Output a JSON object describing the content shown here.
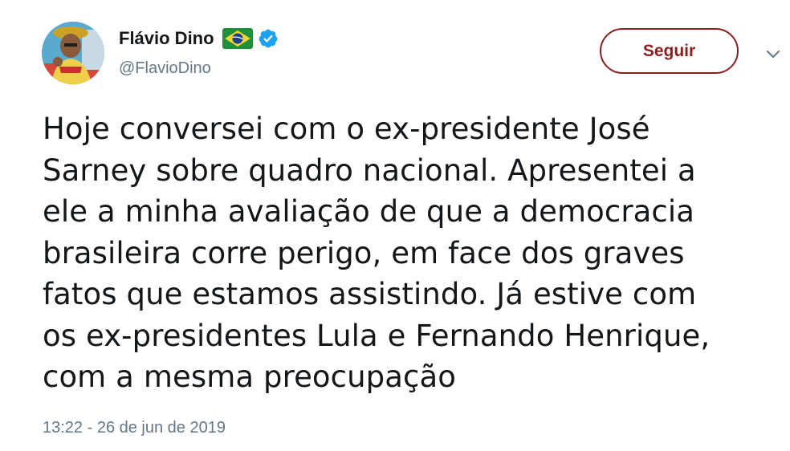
{
  "author": {
    "display_name": "Flávio Dino",
    "handle": "@FlavioDino",
    "flag_icon": "brazil-flag-icon",
    "verified_icon": "verified-badge-icon",
    "verified_color": "#1da1f2"
  },
  "actions": {
    "follow_label": "Seguir",
    "follow_color": "#8b1f1f",
    "more_icon": "chevron-down-icon"
  },
  "tweet": {
    "lines": [
      "Hoje conversei com o ex-presidente José",
      "Sarney sobre quadro nacional. Apresentei a",
      "ele a minha avaliação de que a democracia",
      "brasileira corre perigo, em face dos graves",
      "fatos que estamos assistindo. Já estive com",
      "os ex-presidentes Lula e Fernando Henrique,",
      "com a mesma preocupação"
    ],
    "timestamp": "13:22 - 26 de jun de 2019"
  }
}
